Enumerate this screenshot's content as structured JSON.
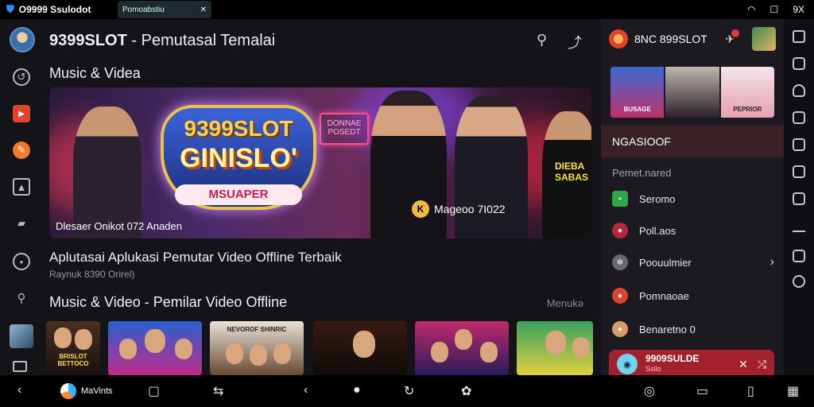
{
  "statusbar": {
    "app_label": "O9999 Ssulodot",
    "tab_label": "Pomoabstiu",
    "tab_close": "✕",
    "wifi": "◠",
    "window": "☐",
    "close": "9X"
  },
  "header": {
    "title_brand": "9399SLOT",
    "title_rest": " - Pemutasal Temalai"
  },
  "sections": {
    "music_video": "Music & Videa",
    "music_video_2": "Music & Video - Pemilar Video Offline",
    "more": "Menukə"
  },
  "hero": {
    "logo_top": "9399SLOT",
    "logo_main": "GINISLO'",
    "logo_ribbon": "MSUAPER",
    "caption": "Dlesaer Onikot 072 Anaden",
    "tag_icon": "K",
    "tag": "Mageoo 7I022",
    "neon_sign": "DONNAE POSEDT",
    "shirt_text": "DIEBA SABAS"
  },
  "article": {
    "headline": "Aplutasai Aplukasi Pemutar Video Offline Terbaik",
    "subline": "Raynuk 8390 Orirel)"
  },
  "panel": {
    "title": "8NC 899SLOT",
    "active_item": "NGASIOOF",
    "sub_heading": "Pemet.nared",
    "items": [
      {
        "label": "Seromo",
        "icon_color": "#2fa84a"
      },
      {
        "label": "Poll.aos",
        "icon_color": "#b4283a"
      },
      {
        "label": "Poouulmier",
        "icon_color": "#6b6870"
      },
      {
        "label": "Pomnaoae",
        "icon_color": "#d9452c"
      },
      {
        "label": "Benaretno 0",
        "icon_color": "#d89c6a"
      }
    ],
    "thumb_captions": [
      "BUSAGE",
      "",
      "PEPRIOR"
    ],
    "card": {
      "icon": "◉",
      "label": "9909SULDE",
      "sublabel": "Ssllo"
    }
  },
  "nav": {
    "active_label": "MaVints"
  },
  "thumbs_captions": [
    "BRISLOT BETTOCO",
    "",
    "NEVOROF SHINRIC",
    "",
    "",
    ""
  ],
  "colors": {
    "accent_red": "#a3202e",
    "panel_bg": "#1c1a20",
    "main_bg": "#141317"
  }
}
